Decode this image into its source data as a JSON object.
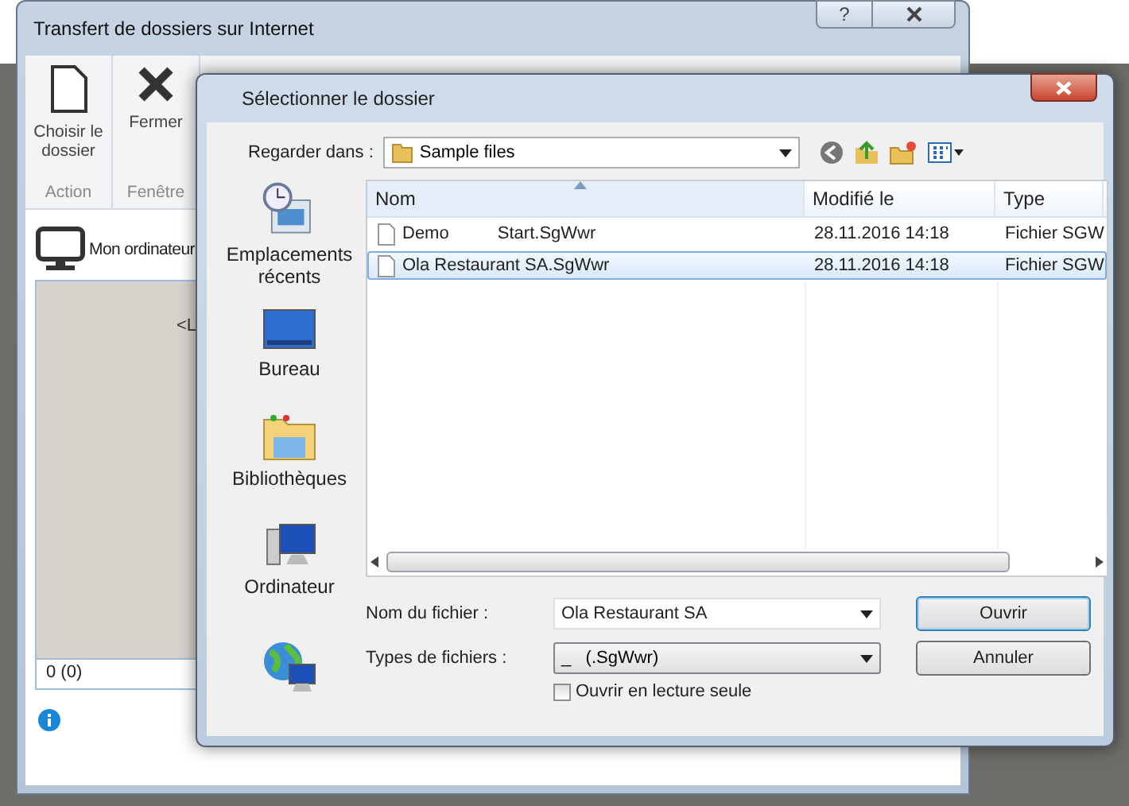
{
  "main_window": {
    "title": "Transfert de dossiers sur Internet",
    "help": "?",
    "ribbon": [
      {
        "label": "Action",
        "buttons": [
          {
            "label": "Choisir le dossier",
            "kind": "document"
          }
        ]
      },
      {
        "label": "Fenêtre",
        "buttons": [
          {
            "label": "Fermer",
            "kind": "close"
          }
        ]
      }
    ],
    "location": "Mon ordinateur",
    "panel_text": "<L",
    "status": "0 (0)"
  },
  "dialog": {
    "title": "Sélectionner le dossier",
    "look_in_label": "Regarder dans :",
    "look_in": "Sample files",
    "places": [
      {
        "label": "Emplacements récents",
        "kind": "recent"
      },
      {
        "label": "Bureau",
        "kind": "desktop"
      },
      {
        "label": "Bibliothèques",
        "kind": "libraries"
      },
      {
        "label": "Ordinateur",
        "kind": "computer"
      },
      {
        "kind": "network"
      }
    ],
    "columns": [
      "Nom",
      "Modifié le",
      "Type"
    ],
    "files": [
      {
        "name": "Demo          Start.SgWwr",
        "modified": "28.11.2016 14:18",
        "type": "Fichier SGW",
        "selected": false
      },
      {
        "name": "Ola Restaurant SA.SgWwr",
        "modified": "28.11.2016 14:18",
        "type": "Fichier SGW",
        "selected": true
      }
    ],
    "file_name_label": "Nom du fichier :",
    "file_name": "Ola Restaurant SA",
    "file_type_label": "Types de fichiers :",
    "file_type": "_   (.SgWwr)",
    "read_only": {
      "label": "Ouvrir en lecture seule",
      "checked": false
    },
    "buttons": [
      "Ouvrir",
      "Annuler"
    ]
  }
}
